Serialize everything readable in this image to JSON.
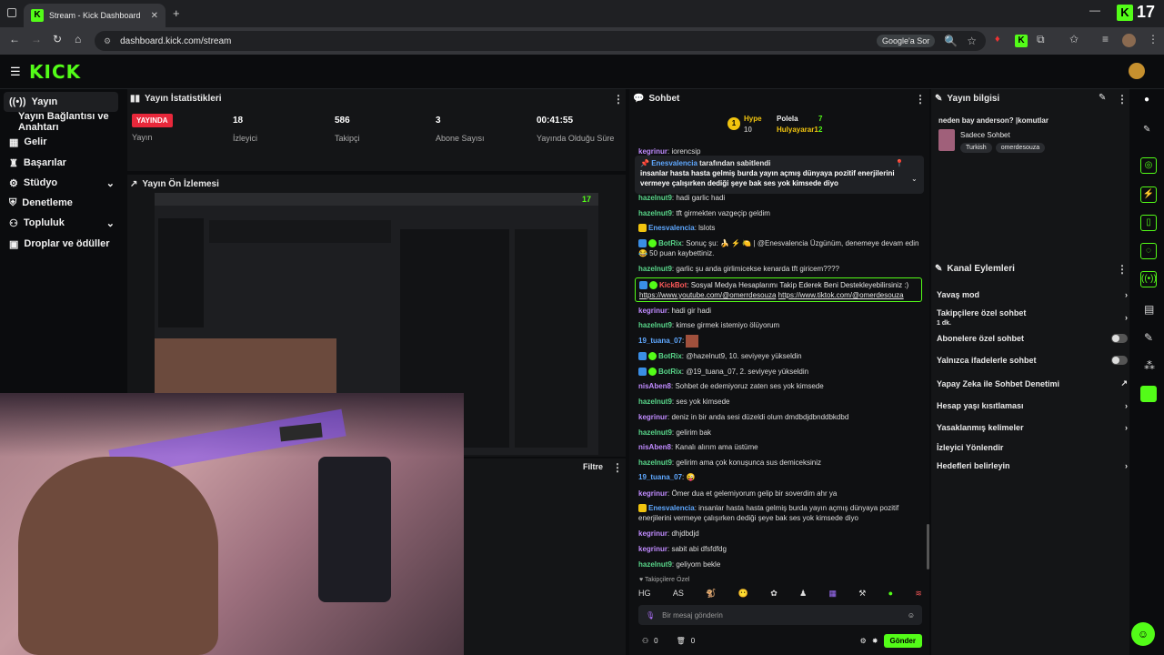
{
  "browser": {
    "tab_title": "Stream - Kick Dashboard",
    "url": "dashboard.kick.com/stream",
    "google_lens": "Google'a Sor",
    "top_right_count": "17"
  },
  "sidebar": {
    "items": [
      {
        "label": "Yayın"
      },
      {
        "label": "Yayın Bağlantısı ve Anahtarı"
      },
      {
        "label": "Gelir"
      },
      {
        "label": "Başarılar"
      },
      {
        "label": "Stüdyo"
      },
      {
        "label": "Denetleme"
      },
      {
        "label": "Topluluk"
      },
      {
        "label": "Droplar ve ödüller"
      }
    ]
  },
  "stats": {
    "title": "Yayın İstatistikleri",
    "live_badge": "YAYINDA",
    "live_label": "Yayın",
    "viewers_value": "18",
    "viewers_label": "İzleyici",
    "followers_value": "586",
    "followers_label": "Takipçi",
    "subs_value": "3",
    "subs_label": "Abone Sayısı",
    "uptime_value": "00:41:55",
    "uptime_label": "Yayında Olduğu Süre"
  },
  "preview": {
    "title": "Yayın Ön İzlemesi",
    "count": "17",
    "filter_label": "Filtre"
  },
  "chat": {
    "title": "Sohbet",
    "leaders": [
      {
        "rank": "1",
        "name": "Hype",
        "score": "10"
      },
      {
        "name": "Polela",
        "score": "7"
      },
      {
        "name": "Hulyayarar1",
        "score": "2"
      }
    ],
    "pinned_by": "Enesvalencia",
    "pinned_suffix": "tarafından sabitlendi",
    "pinned_text": "insanlar hasta hasta gelmiş burda yayın açmış dünyaya pozitif enerjilerini vermeye çalışırken dediği şeye bak ses yok kimsede diyo",
    "messages": [
      {
        "user": "kegrinur",
        "text": "iorencsip"
      },
      {
        "user": "hazelnut9",
        "text": "hadi garlic hadi"
      },
      {
        "user": "hazelnut9",
        "text": "tft girmekten vazgeçip geldim"
      },
      {
        "user": "Enesvalencia",
        "text": "lslots"
      },
      {
        "user": "BotRix",
        "text": "Sonuç şu: 🍌 ⚡ 🍋 | @Enesvalencia Üzgünüm, denemeye devam edin 😂 50 puan kaybettiniz."
      },
      {
        "user": "hazelnut9",
        "text": "garlic şu anda girlimicekse kenarda tft giricem????"
      },
      {
        "user": "KickBot",
        "text": "Sosyal Medya Hesaplarımı Takip Ederek Beni Destekleyebilirsiniz :)",
        "link1": "https://www.youtube.com/@omerrdesouza",
        "link2": "https://www.tiktok.com/@omerdesouza"
      },
      {
        "user": "kegrinur",
        "text": "hadi gir hadi"
      },
      {
        "user": "hazelnut9",
        "text": "kimse girmek istemiyo ölüyorum"
      },
      {
        "user": "19_tuana_07",
        "text": ""
      },
      {
        "user": "BotRix",
        "text": "@hazelnut9, 10. seviyeye yükseldin"
      },
      {
        "user": "BotRix",
        "text": "@19_tuana_07, 2. seviyeye yükseldin"
      },
      {
        "user": "nisAben8",
        "text": "Sohbet de edemiyoruz zaten ses yok kimsede"
      },
      {
        "user": "hazelnut9",
        "text": "ses yok kimsede"
      },
      {
        "user": "kegrinur",
        "text": "deniz in bir anda sesi düzeldi olum dmdbdjdbnddbkdbd"
      },
      {
        "user": "hazelnut9",
        "text": "gelirim bak"
      },
      {
        "user": "nisAben8",
        "text": "Kanalı alırım ama üstüme"
      },
      {
        "user": "hazelnut9",
        "text": "gelirim ama çok konuşunca sus demiceksiniz"
      },
      {
        "user": "19_tuana_07",
        "text": "😜"
      },
      {
        "user": "kegrinur",
        "text": "Ömer dua et gelemiyorum gelip bir soverdim ahr ya"
      },
      {
        "user": "Enesvalencia",
        "text": "insanlar hasta hasta gelmiş burda yayın açmış dünyaya pozitif enerjilerini vermeye çalışırken dediği şeye bak ses yok kimsede diyo"
      },
      {
        "user": "kegrinur",
        "text": "dhjdbdjd"
      },
      {
        "user": "kegrinur",
        "text": "sabit abi dfsfdfdg"
      },
      {
        "user": "hazelnut9",
        "text": "geliyom bekle"
      }
    ],
    "followers_only": "Takipçilere Özel",
    "input_placeholder": "Bir mesaj gönderin",
    "bottom_count": "0",
    "send_label": "Gönder"
  },
  "stream_info": {
    "title": "Yayın bilgisi",
    "stream_title": "neden bay anderson? |komutlar",
    "category": "Sadece Sohbet",
    "tags": [
      "Turkish",
      "omerdesouza"
    ]
  },
  "channel_actions": {
    "title": "Kanal Eylemleri",
    "items": [
      {
        "label": "Yavaş mod"
      },
      {
        "label": "Takipçilere özel sohbet",
        "sub": "1 dk."
      },
      {
        "label": "Abonelere özel sohbet"
      },
      {
        "label": "Yalnızca ifadelerle sohbet"
      },
      {
        "label": "Yapay Zeka ile Sohbet Denetimi"
      },
      {
        "label": "Hesap yaşı kısıtlaması"
      },
      {
        "label": "Yasaklanmış kelimeler"
      },
      {
        "label": "İzleyici Yönlendir"
      },
      {
        "label": "Hedefleri belirleyin"
      }
    ]
  },
  "colors": {
    "accent": "#53fc18",
    "live": "#e8283b"
  }
}
